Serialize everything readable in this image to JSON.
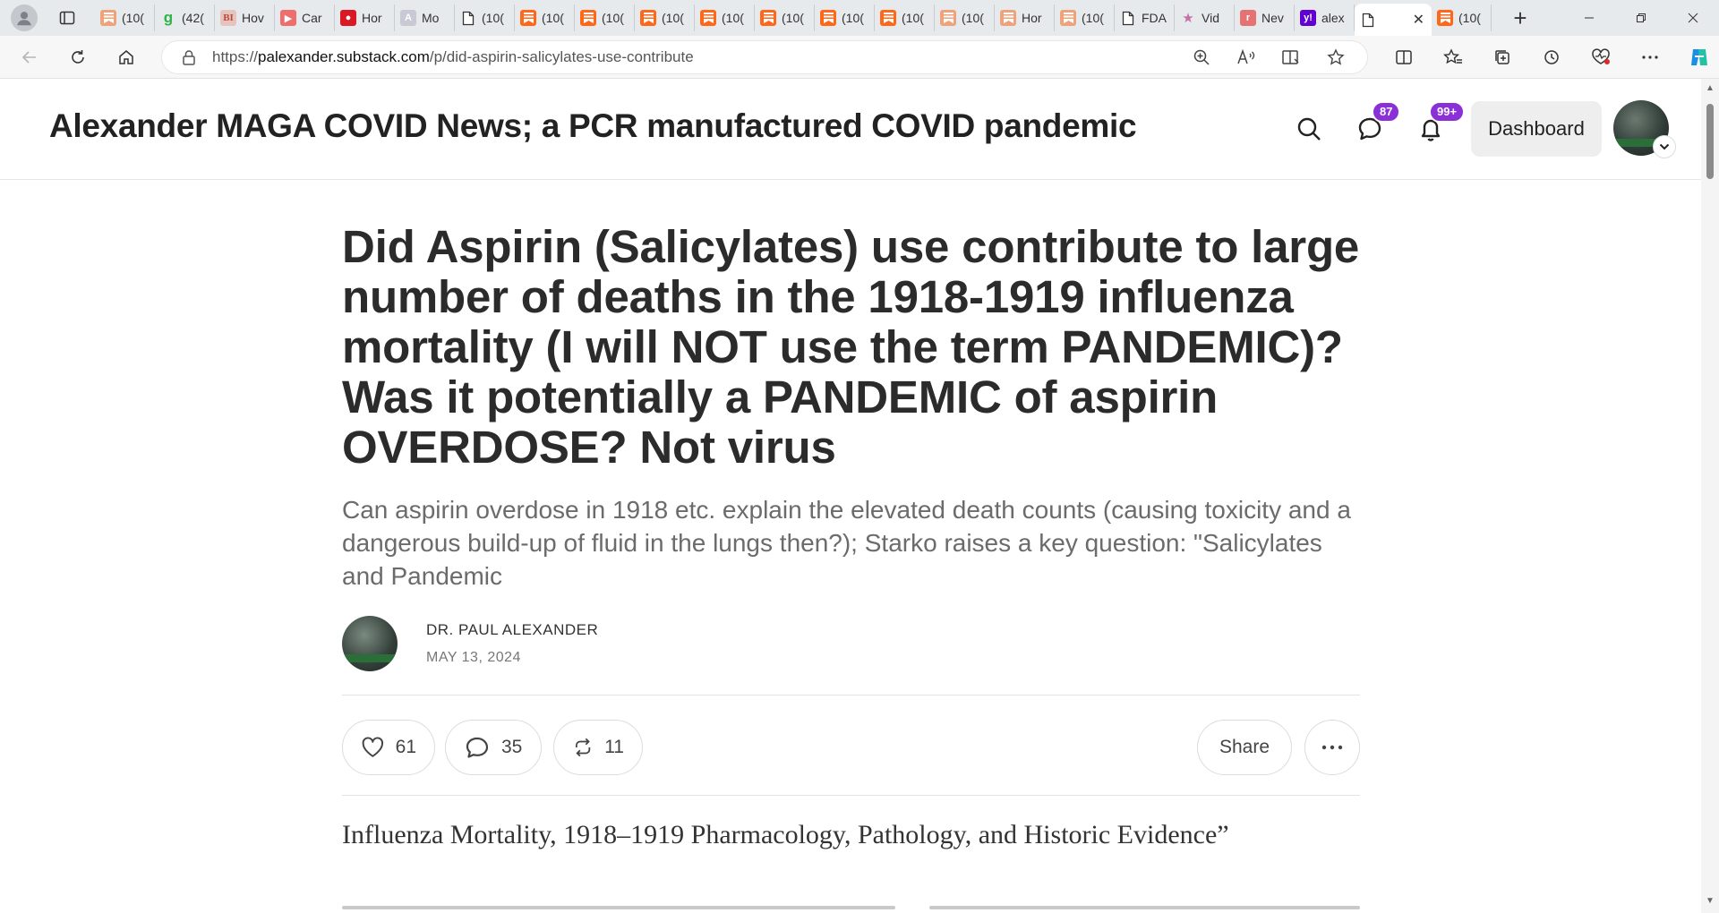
{
  "browser": {
    "tabs": [
      {
        "label": "(10(",
        "favicon": "substack-faded",
        "color": "#f0a27a"
      },
      {
        "label": "(42(",
        "favicon": "green-g",
        "color": "#2fb344"
      },
      {
        "label": "Hov",
        "favicon": "bi-logo",
        "color": "#e7c3bd"
      },
      {
        "label": "Car",
        "favicon": "youtube",
        "color": "#ee6d6d"
      },
      {
        "label": "Hor",
        "favicon": "red-pin",
        "color": "#d91a25"
      },
      {
        "label": "Mo",
        "favicon": "ai-logo",
        "color": "#c9c9d6"
      },
      {
        "label": "(10(",
        "favicon": "page",
        "color": "#ffffff"
      },
      {
        "label": "(10(",
        "favicon": "substack",
        "color": "#ff6719"
      },
      {
        "label": "(10(",
        "favicon": "substack",
        "color": "#ff6719"
      },
      {
        "label": "(10(",
        "favicon": "substack",
        "color": "#ff6719"
      },
      {
        "label": "(10(",
        "favicon": "substack",
        "color": "#ff6719"
      },
      {
        "label": "(10(",
        "favicon": "substack",
        "color": "#ff6719"
      },
      {
        "label": "(10(",
        "favicon": "substack",
        "color": "#ff6719"
      },
      {
        "label": "(10(",
        "favicon": "substack",
        "color": "#ff6719"
      },
      {
        "label": "(10(",
        "favicon": "substack-faded",
        "color": "#f0a27a"
      },
      {
        "label": "Hor",
        "favicon": "substack-faded",
        "color": "#f0a27a"
      },
      {
        "label": "(10(",
        "favicon": "substack-faded",
        "color": "#f0a27a"
      },
      {
        "label": "FDA",
        "favicon": "page",
        "color": "#ffffff"
      },
      {
        "label": "Vid",
        "favicon": "star",
        "color": "#e6c3d8"
      },
      {
        "label": "Nev",
        "favicon": "red-square",
        "color": "#e57373"
      },
      {
        "label": "alex",
        "favicon": "yahoo",
        "color": "#6001d2"
      }
    ],
    "active_tab": {
      "label": "",
      "favicon": "page"
    },
    "trailing_tab": {
      "label": "(10(",
      "favicon": "substack",
      "color": "#ff6719"
    },
    "new_tab_symbol": "+",
    "url_prefix": "https://",
    "url_host": "palexander.substack.com",
    "url_path": "/p/did-aspirin-salicylates-use-contribute"
  },
  "site": {
    "title": "Alexander MAGA COVID News; a PCR manufactured COVID pandemic",
    "messages_badge": "87",
    "notifications_badge": "99+",
    "dashboard_label": "Dashboard",
    "accent": "#8b30d6"
  },
  "article": {
    "title": "Did Aspirin (Salicylates) use contribute to large number of deaths in the 1918-1919 influenza mortality (I will NOT use the term PANDEMIC)? Was it potentially a PANDEMIC of aspirin OVERDOSE? Not virus",
    "subtitle": "Can aspirin overdose in 1918 etc. explain the elevated death counts (causing toxicity and a dangerous build-up of fluid in the lungs then?); Starko raises a key question: \"Salicylates and Pandemic",
    "author": "DR. PAUL ALEXANDER",
    "date": "MAY 13, 2024",
    "likes": "61",
    "comments": "35",
    "restacks": "11",
    "share_label": "Share",
    "body_first_line": "Influenza Mortality, 1918–1919 Pharmacology, Pathology, and Historic Evidence”"
  }
}
